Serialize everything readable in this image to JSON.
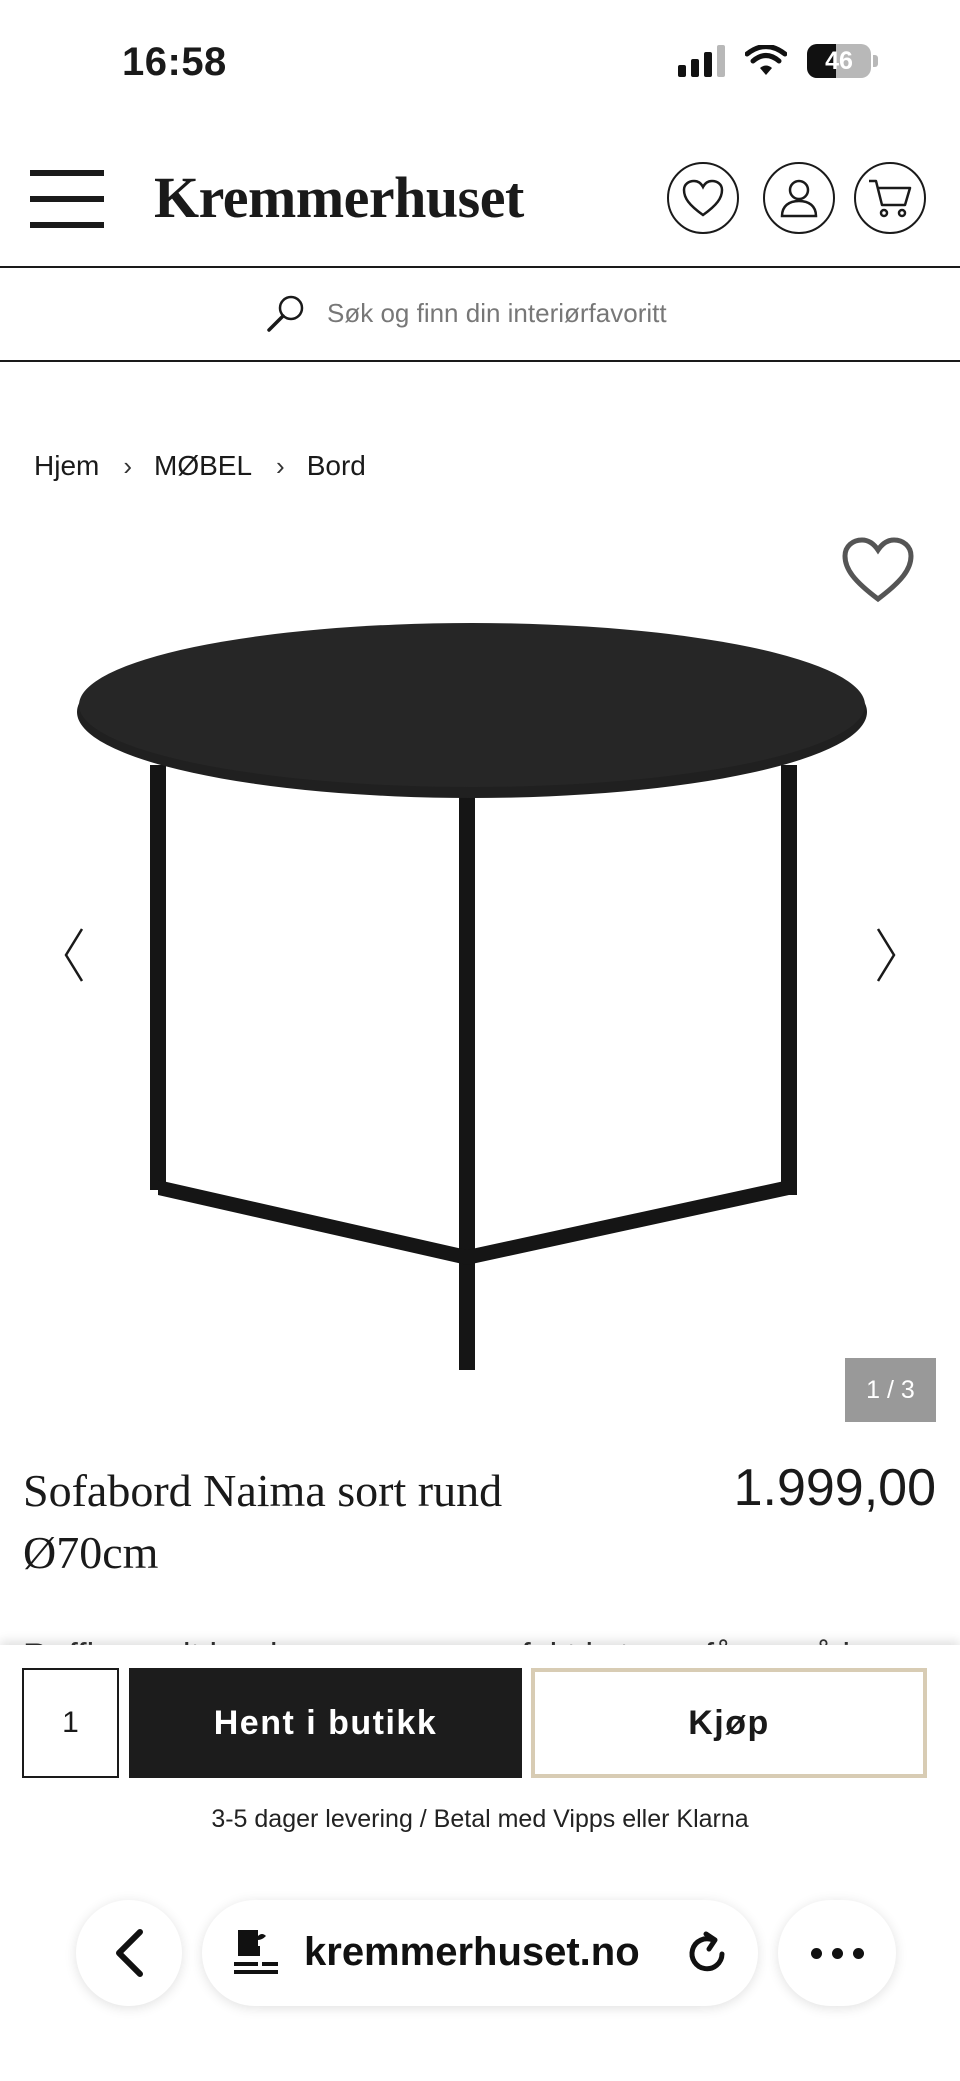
{
  "status_bar": {
    "time": "16:58",
    "battery": "46",
    "battery_level_pct": 46,
    "icons": [
      "signal-icon",
      "wifi-icon",
      "battery-icon"
    ]
  },
  "header": {
    "brand": "Kremmerhuset",
    "icons": [
      "hamburger-menu-icon",
      "heart-icon",
      "user-icon",
      "cart-icon"
    ]
  },
  "search": {
    "placeholder": "Søk og finn din interiørfavoritt"
  },
  "breadcrumb": [
    {
      "label": "Hjem"
    },
    {
      "label": "MØBEL"
    },
    {
      "label": "Bord"
    }
  ],
  "gallery": {
    "counter": "1 / 3",
    "current": 1,
    "total": 3
  },
  "product": {
    "title_line1": "Sofabord Naima sort rund",
    "title_line2": "Ø70cm",
    "price": "1.999,00",
    "description_start": "Røffig rundt bord som passer perfekt i stuen, fås også i"
  },
  "buy_bar": {
    "quantity": "1",
    "pickup_label": "Hent i butikk",
    "buy_label": "Kjøp",
    "delivery_info": "3-5 dager levering / Betal med Vipps eller Klarna"
  },
  "browser": {
    "url": "kremmerhuset.no"
  },
  "colors": {
    "primary": "#1c1c1c",
    "accent_border": "#d8ccb4",
    "counter_bg": "#999999"
  }
}
